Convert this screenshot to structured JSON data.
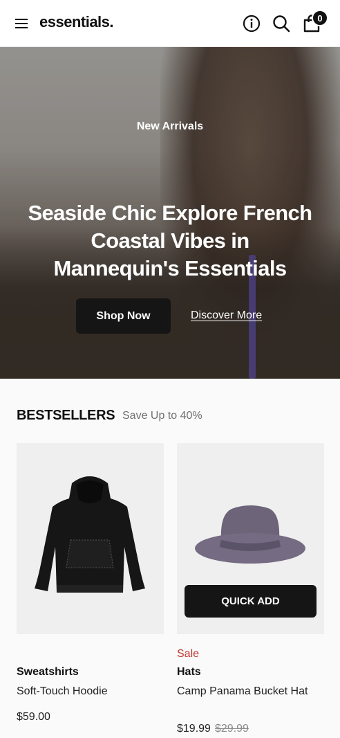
{
  "header": {
    "logo": "essentials.",
    "icons": [
      "menu-icon",
      "info-icon",
      "search-icon",
      "bag-icon"
    ],
    "bag_count": "0"
  },
  "hero": {
    "kicker": "New Arrivals",
    "title": "Seaside Chic Explore French Coastal Vibes in Mannequin's Essentials",
    "shop_label": "Shop Now",
    "discover_label": "Discover More",
    "slides": 3,
    "active_slide": 1
  },
  "bestsellers": {
    "title": "BESTSELLERS",
    "subtitle": "Save Up to 40%",
    "products": [
      {
        "category": "Sweatshirts",
        "name": "Soft-Touch Hoodie",
        "price": "$59.00",
        "image": "black-hoodie"
      },
      {
        "sale": "Sale",
        "category": "Hats",
        "name": "Camp Panama Bucket Hat",
        "price": "$19.99",
        "old_price": "$29.99",
        "quick_add": "QUICK ADD",
        "image": "purple-bucket-hat"
      }
    ]
  },
  "colors": {
    "accent": "#151515",
    "sale": "#c0352b"
  }
}
